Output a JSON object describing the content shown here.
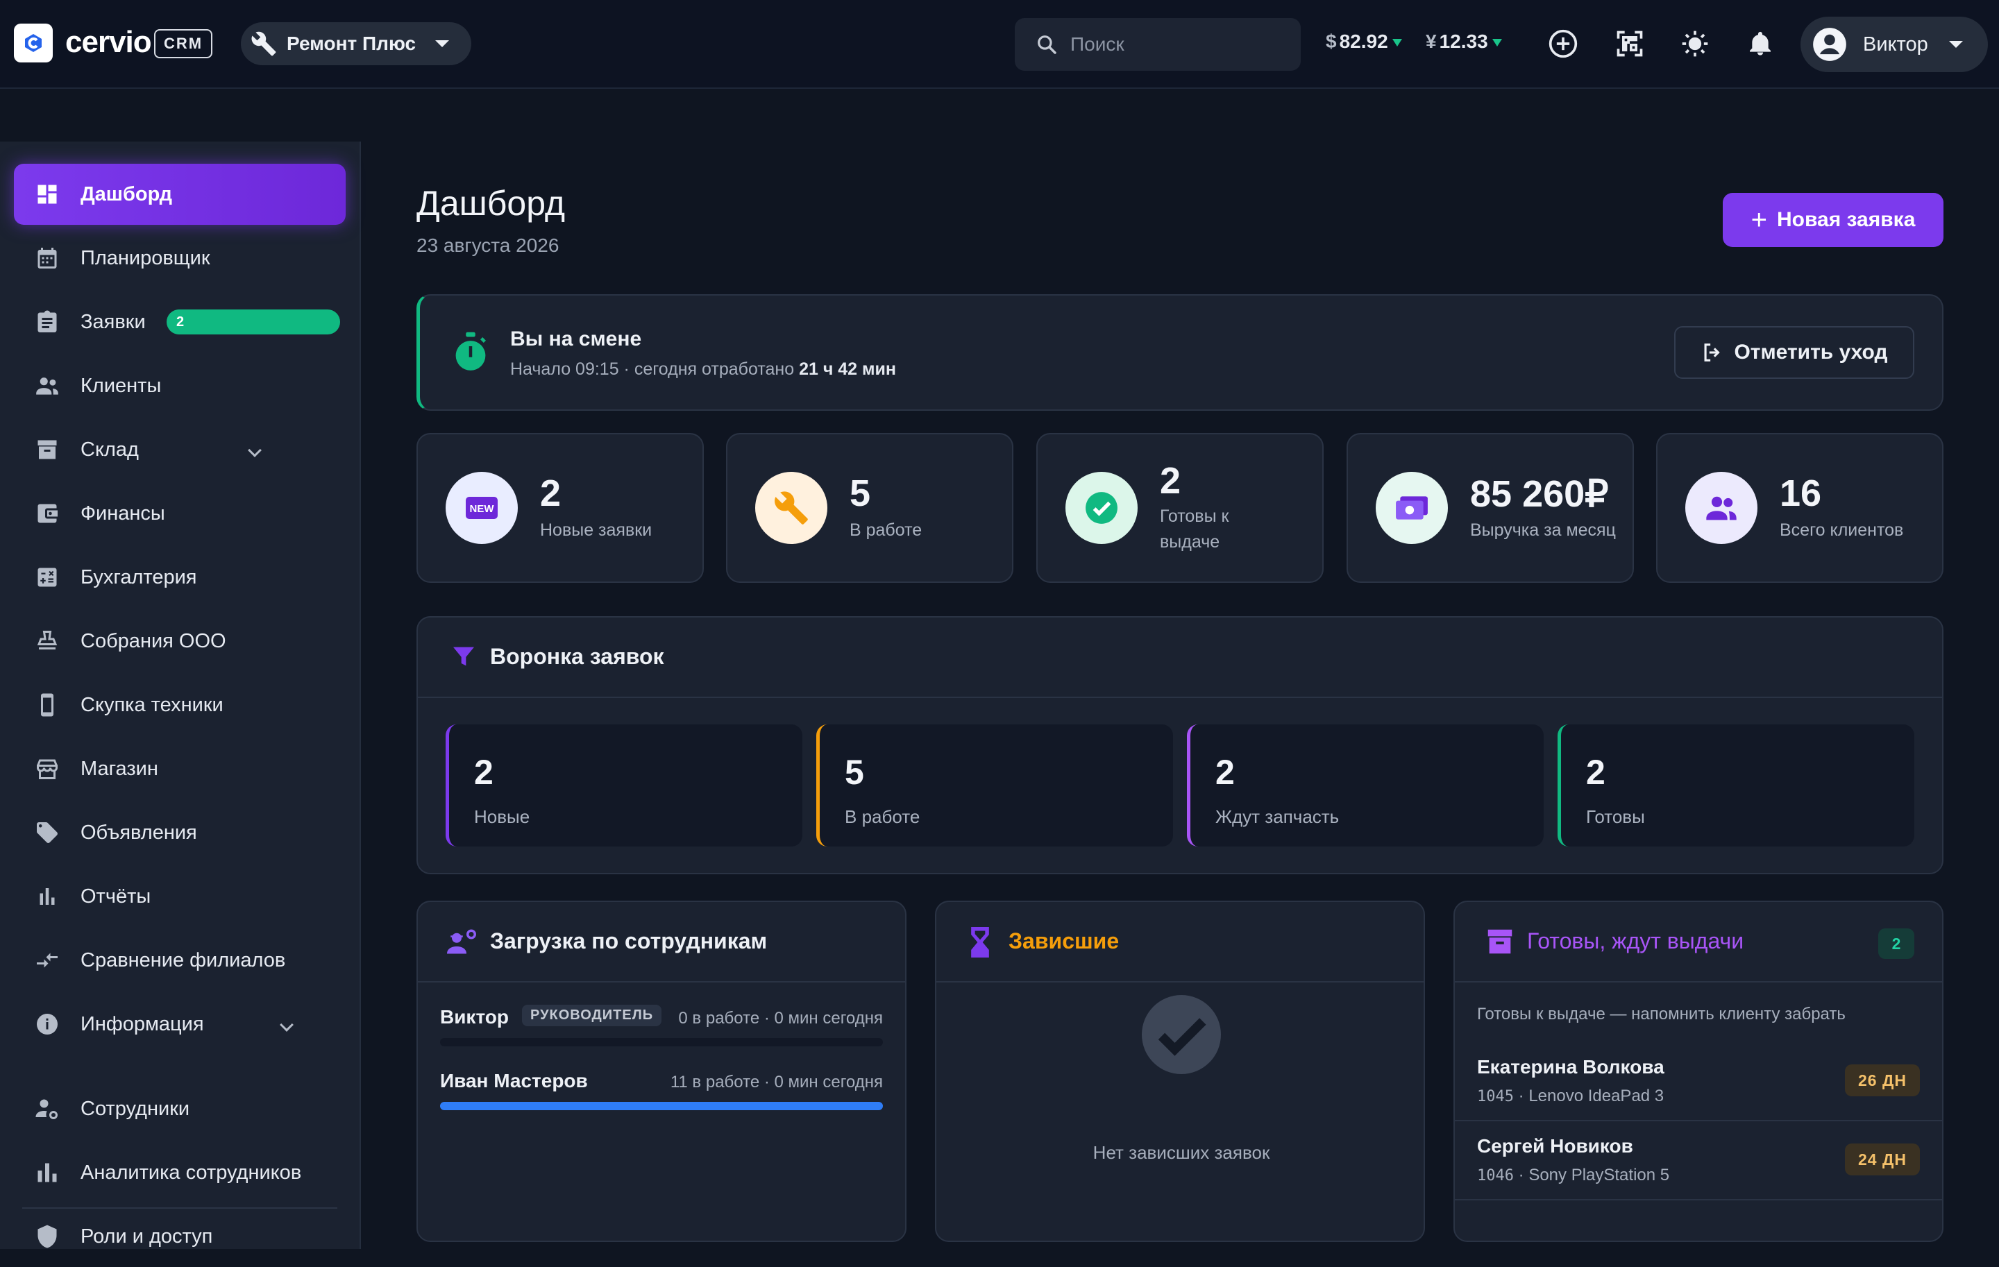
{
  "app": {
    "logo_text": "cervio",
    "crm_label": "CRM"
  },
  "header": {
    "branch": "Ремонт Плюс",
    "search_placeholder": "Поиск",
    "currency": [
      {
        "symbol": "$",
        "value": "82.92"
      },
      {
        "symbol": "¥",
        "value": "12.33"
      }
    ],
    "user": "Виктор"
  },
  "sidebar": {
    "items": [
      {
        "label": "Дашборд"
      },
      {
        "label": "Планировщик"
      },
      {
        "label": "Заявки",
        "badge": "2"
      },
      {
        "label": "Клиенты"
      },
      {
        "label": "Склад"
      },
      {
        "label": "Финансы"
      },
      {
        "label": "Бухгалтерия"
      },
      {
        "label": "Собрания ООО"
      },
      {
        "label": "Скупка техники"
      },
      {
        "label": "Магазин"
      },
      {
        "label": "Объявления"
      },
      {
        "label": "Отчёты"
      },
      {
        "label": "Сравнение филиалов"
      },
      {
        "label": "Информация"
      },
      {
        "label": "Сотрудники"
      },
      {
        "label": "Аналитика сотрудников"
      },
      {
        "label": "Роли и доступ"
      }
    ]
  },
  "page": {
    "title": "Дашборд",
    "date": "23 августа 2026",
    "new_button": "Новая заявка"
  },
  "shift": {
    "title": "Вы на смене",
    "subtitle": "Начало 09:15 · сегодня отработано",
    "worked": "21 ч 42 мин",
    "leave_button": "Отметить уход"
  },
  "stats": [
    {
      "value": "2",
      "label": "Новые заявки",
      "icon": "new-icon"
    },
    {
      "value": "5",
      "label": "В работе",
      "icon": "wrench-icon"
    },
    {
      "value": "2",
      "label": "Готовы к выдаче",
      "icon": "check-icon"
    },
    {
      "value": "85 260₽",
      "label": "Выручка за месяц",
      "icon": "money-icon"
    },
    {
      "value": "16",
      "label": "Всего клиентов",
      "icon": "users-icon"
    }
  ],
  "funnel": {
    "title": "Воронка заявок",
    "stages": [
      {
        "value": "2",
        "label": "Новые",
        "color": "#7c3aed"
      },
      {
        "value": "5",
        "label": "В работе",
        "color": "#f59e0b"
      },
      {
        "value": "2",
        "label": "Ждут запчасть",
        "color": "#a855f7"
      },
      {
        "value": "2",
        "label": "Готовы",
        "color": "#10b981"
      }
    ]
  },
  "workload": {
    "title": "Загрузка по сотрудникам",
    "employees": [
      {
        "name": "Виктор",
        "role": "РУКОВОДИТЕЛЬ",
        "stat": "0 в работе · 0 мин сегодня",
        "load": 0
      },
      {
        "name": "Иван Мастеров",
        "role": "",
        "stat": "11 в работе · 0 мин сегодня",
        "load": 1
      }
    ]
  },
  "stuck": {
    "title": "Зависшие",
    "empty": "Нет зависших заявок"
  },
  "ready": {
    "title": "Готовы, ждут выдачи",
    "count": "2",
    "subtitle": "Готовы к выдаче — напомнить клиенту забрать",
    "items": [
      {
        "name": "Екатерина Волкова",
        "id": "1045",
        "device": "· Lenovo IdeaPad 3",
        "days": "26 ДН"
      },
      {
        "name": "Сергей Новиков",
        "id": "1046",
        "device": "· Sony PlayStation 5",
        "days": "24 ДН"
      }
    ]
  },
  "colors": {
    "accent": "#7c3aed",
    "success": "#10b981",
    "warning": "#f59e0b"
  }
}
